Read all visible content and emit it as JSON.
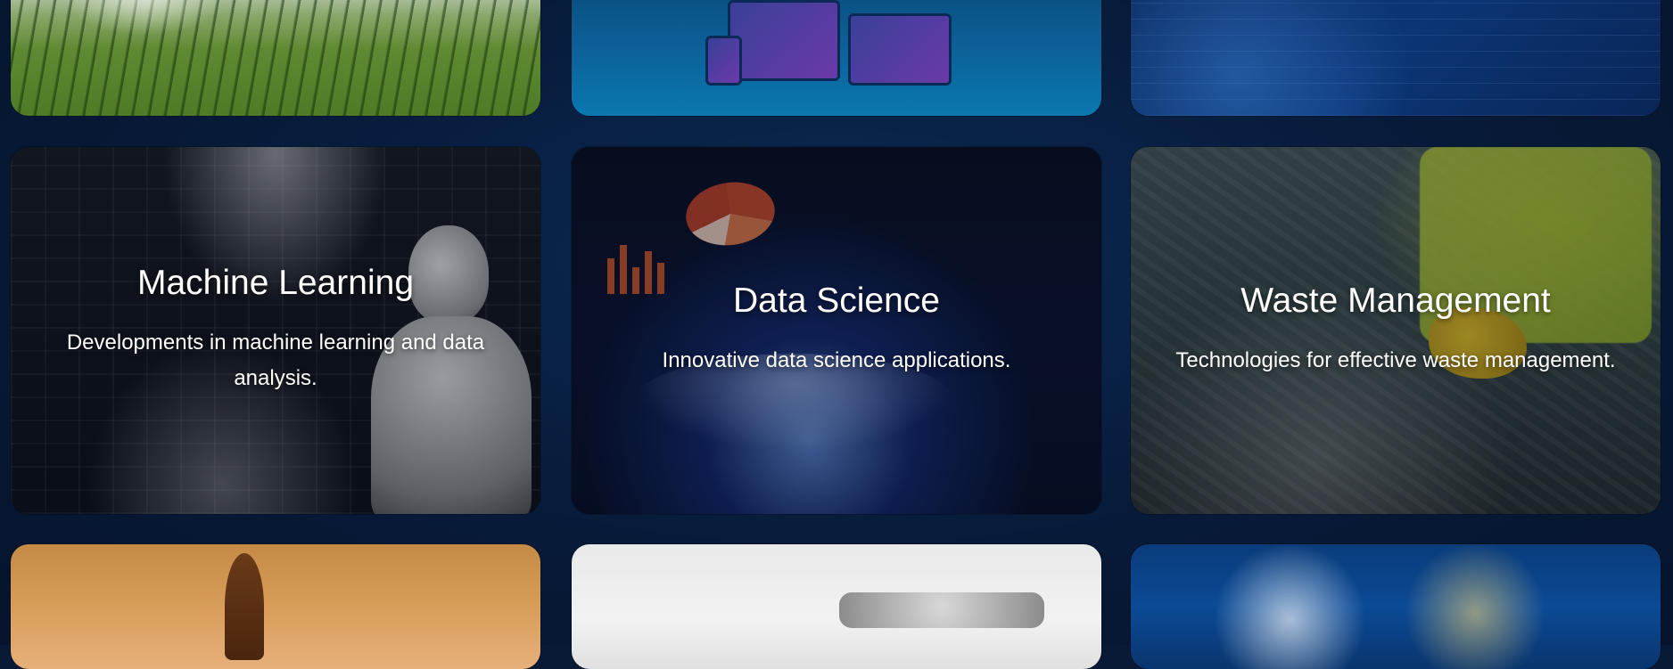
{
  "cards": [
    {
      "title": "Machine Learning",
      "desc": "Developments in machine learning and data analysis."
    },
    {
      "title": "Data Science",
      "desc": "Innovative data science applications."
    },
    {
      "title": "Waste Management",
      "desc": "Technologies for effective waste management."
    }
  ],
  "colors": {
    "page_bg": "#081a35",
    "text": "#ffffff"
  },
  "icons": {
    "row1": [
      "agriculture-image",
      "devices-image",
      "cybersecurity-image"
    ],
    "row2": [
      "machine-learning-image",
      "data-science-image",
      "waste-management-image"
    ],
    "row3": [
      "temple-image",
      "drone-image",
      "gaming-image"
    ]
  }
}
